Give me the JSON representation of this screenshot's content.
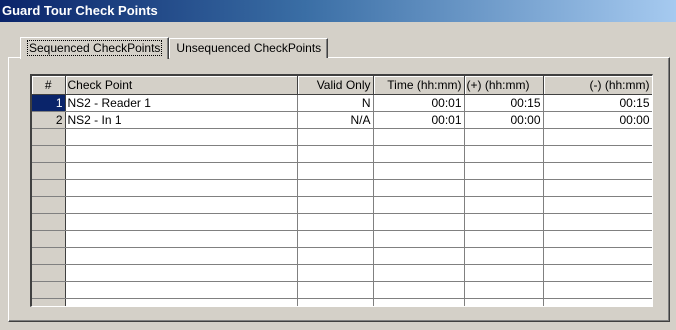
{
  "window": {
    "title": "Guard Tour Check Points"
  },
  "tabs": [
    {
      "label": "Sequenced CheckPoints"
    },
    {
      "label": "Unsequenced CheckPoints"
    }
  ],
  "grid": {
    "columns": [
      "#",
      "Check Point",
      "Valid Only",
      "Time (hh:mm)",
      "(+)  (hh:mm)",
      "(-)  (hh:mm)"
    ],
    "rows": [
      {
        "num": "1",
        "check_point": "NS2 - Reader 1",
        "valid_only": "N",
        "time": "00:01",
        "plus": "00:15",
        "minus": "00:15"
      },
      {
        "num": "2",
        "check_point": "NS2 - In 1",
        "valid_only": "N/A",
        "time": "00:01",
        "plus": "00:00",
        "minus": "00:00"
      }
    ]
  }
}
